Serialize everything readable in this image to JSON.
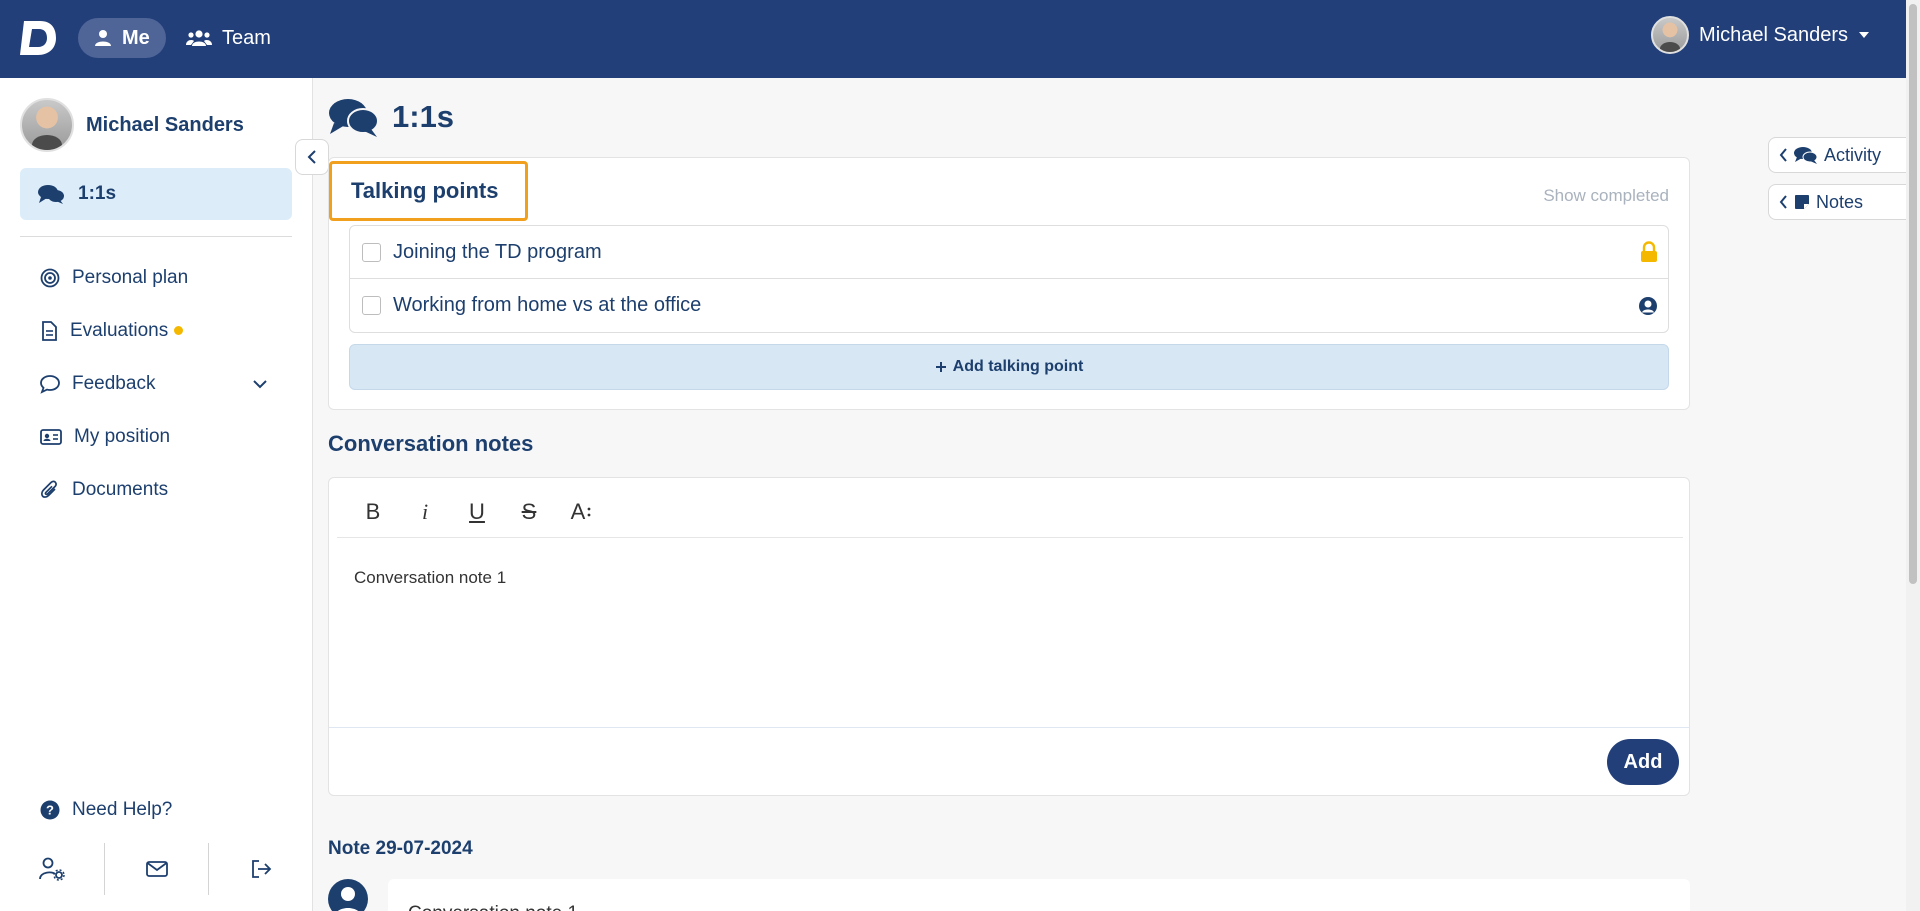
{
  "topbar": {
    "logo_icon": "d-logo-icon",
    "nav": [
      {
        "label": "Me",
        "icon": "user-icon",
        "active": true
      },
      {
        "label": "Team",
        "icon": "users-icon",
        "active": false
      }
    ],
    "user_name": "Michael Sanders"
  },
  "sidebar": {
    "user_name": "Michael Sanders",
    "active_item": {
      "label": "1:1s",
      "icon": "comments-icon"
    },
    "items": [
      {
        "label": "Personal plan",
        "icon": "target-icon"
      },
      {
        "label": "Evaluations",
        "icon": "document-icon",
        "badge_color": "#f5b800"
      },
      {
        "label": "Feedback",
        "icon": "comment-icon"
      },
      {
        "label": "My position",
        "icon": "id-card-icon"
      },
      {
        "label": "Documents",
        "icon": "paperclip-icon"
      }
    ],
    "help_label": "Need Help?"
  },
  "page": {
    "title": "1:1s"
  },
  "talking_points": {
    "title": "Talking points",
    "show_completed": "Show completed",
    "items": [
      {
        "text": "Joining the TD program",
        "icon": "lock-icon",
        "checked": false
      },
      {
        "text": "Working from home vs at the office",
        "icon": "user-circle-icon",
        "checked": false
      }
    ],
    "add_label": "Add talking point"
  },
  "conversation_notes": {
    "title": "Conversation notes",
    "toolbar": [
      "B",
      "i",
      "U",
      "S",
      "A"
    ],
    "body": "Conversation note 1",
    "add_label": "Add"
  },
  "note": {
    "date_label": "Note 29-07-2024",
    "preview": "Conversation note 1"
  },
  "right_tabs": [
    {
      "label": "Activity",
      "icon": "comments-icon"
    },
    {
      "label": "Notes",
      "icon": "sticky-note-icon"
    }
  ],
  "colors": {
    "primary": "#223f7a",
    "text": "#1d3f6e",
    "highlight": "#f0a01d",
    "lock": "#f5b800",
    "active_bg": "#dcedf9"
  }
}
